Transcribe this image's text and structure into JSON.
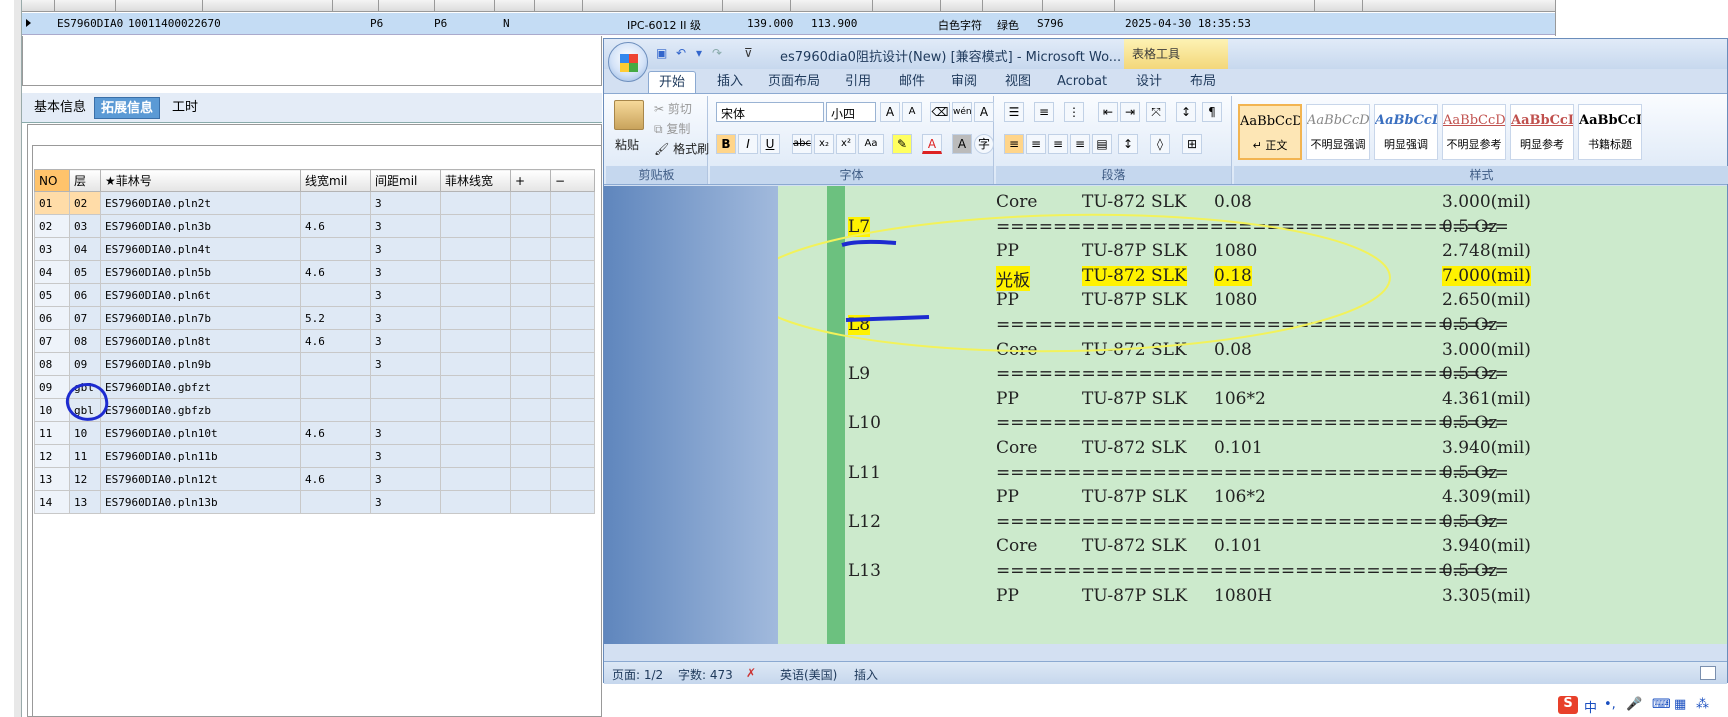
{
  "bg_app": {
    "top_row": {
      "code": "ES7960DIA0",
      "id": "10011400022670",
      "c1": "P6",
      "c2": "P6",
      "c3": "N",
      "grade": "IPC-6012 II 级",
      "v1": "139.000",
      "v2": "113.900",
      "text_type": "白色字符",
      "color": "绿色",
      "s_code": "S796",
      "datetime": "2025-04-30 18:35:53"
    },
    "tabs": [
      "基本信息",
      "拓展信息",
      "工时"
    ],
    "grid": {
      "columns": [
        "NO",
        "层",
        "★菲林号",
        "线宽mil",
        "间距mil",
        "菲林线宽",
        "+",
        "−"
      ],
      "rows": [
        [
          "01",
          "02",
          "ES7960DIA0.pln2t",
          "",
          "3",
          "",
          "",
          ""
        ],
        [
          "02",
          "03",
          "ES7960DIA0.pln3b",
          "4.6",
          "3",
          "",
          "",
          ""
        ],
        [
          "03",
          "04",
          "ES7960DIA0.pln4t",
          "",
          "3",
          "",
          "",
          ""
        ],
        [
          "04",
          "05",
          "ES7960DIA0.pln5b",
          "4.6",
          "3",
          "",
          "",
          ""
        ],
        [
          "05",
          "06",
          "ES7960DIA0.pln6t",
          "",
          "3",
          "",
          "",
          ""
        ],
        [
          "06",
          "07",
          "ES7960DIA0.pln7b",
          "5.2",
          "3",
          "",
          "",
          ""
        ],
        [
          "07",
          "08",
          "ES7960DIA0.pln8t",
          "4.6",
          "3",
          "",
          "",
          ""
        ],
        [
          "08",
          "09",
          "ES7960DIA0.pln9b",
          "",
          "3",
          "",
          "",
          ""
        ],
        [
          "09",
          "gbl",
          "ES7960DIA0.gbfzt",
          "",
          "",
          "",
          "",
          ""
        ],
        [
          "10",
          "gbl",
          "ES7960DIA0.gbfzb",
          "",
          "",
          "",
          "",
          ""
        ],
        [
          "11",
          "10",
          "ES7960DIA0.pln10t",
          "4.6",
          "3",
          "",
          "",
          ""
        ],
        [
          "12",
          "11",
          "ES7960DIA0.pln11b",
          "",
          "3",
          "",
          "",
          ""
        ],
        [
          "13",
          "12",
          "ES7960DIA0.pln12t",
          "4.6",
          "3",
          "",
          "",
          ""
        ],
        [
          "14",
          "13",
          "ES7960DIA0.pln13b",
          "",
          "3",
          "",
          "",
          ""
        ]
      ]
    }
  },
  "word": {
    "title": "es7960dia0阻抗设计(New) [兼容模式] - Microsoft Wo...",
    "table_tools": "表格工具",
    "ribbon_tabs": [
      "开始",
      "插入",
      "页面布局",
      "引用",
      "邮件",
      "审阅",
      "视图",
      "Acrobat",
      "设计",
      "布局"
    ],
    "clipboard": {
      "paste": "粘贴",
      "cut": "剪切",
      "copy": "复制",
      "format_painter": "格式刷",
      "label": "剪贴板"
    },
    "font": {
      "name": "宋体",
      "size": "小四",
      "label": "字体"
    },
    "paragraph": {
      "label": "段落"
    },
    "styles": {
      "label": "样式",
      "items": [
        {
          "preview": "AaBbCcDc",
          "name": "↵ 正文"
        },
        {
          "preview": "AaBbCcDc",
          "name": "不明显强调"
        },
        {
          "preview": "AaBbCcDc",
          "name": "明显强调"
        },
        {
          "preview": "AaBbCcDc",
          "name": "不明显参考"
        },
        {
          "preview": "AaBbCcI",
          "name": "明显参考"
        },
        {
          "preview": "AaBbCcI",
          "name": "书籍标题"
        }
      ]
    },
    "doc_lines": [
      {
        "layer": "",
        "material": "Core",
        "spec": "TU-872 SLK",
        "val": "0.08",
        "thk": "3.000(mil)"
      },
      {
        "layer": "L7",
        "material": "====================================",
        "spec": "",
        "val": "",
        "thk": "0.5 Oz"
      },
      {
        "layer": "",
        "material": "PP",
        "spec": "TU-87P SLK",
        "val": "1080",
        "thk": "2.748(mil)"
      },
      {
        "layer": "",
        "material": "光板",
        "spec": "TU-872 SLK",
        "val": "0.18",
        "thk": "7.000(mil)"
      },
      {
        "layer": "",
        "material": "PP",
        "spec": "TU-87P SLK",
        "val": "1080",
        "thk": "2.650(mil)"
      },
      {
        "layer": "L8",
        "material": "====================================",
        "spec": "",
        "val": "",
        "thk": "0.5 Oz"
      },
      {
        "layer": "",
        "material": "Core",
        "spec": "TU-872 SLK",
        "val": "0.08",
        "thk": "3.000(mil)"
      },
      {
        "layer": "L9",
        "material": "====================================",
        "spec": "",
        "val": "",
        "thk": "0.5 Oz"
      },
      {
        "layer": "",
        "material": "PP",
        "spec": "TU-87P SLK",
        "val": "106*2",
        "thk": "4.361(mil)"
      },
      {
        "layer": "L10",
        "material": "====================================",
        "spec": "",
        "val": "",
        "thk": "0.5 Oz"
      },
      {
        "layer": "",
        "material": "Core",
        "spec": "TU-872 SLK",
        "val": "0.101",
        "thk": "3.940(mil)"
      },
      {
        "layer": "L11",
        "material": "====================================",
        "spec": "",
        "val": "",
        "thk": "0.5 Oz"
      },
      {
        "layer": "",
        "material": "PP",
        "spec": "TU-87P SLK",
        "val": "106*2",
        "thk": "4.309(mil)"
      },
      {
        "layer": "L12",
        "material": "====================================",
        "spec": "",
        "val": "",
        "thk": "0.5 Oz"
      },
      {
        "layer": "",
        "material": "Core",
        "spec": "TU-872 SLK",
        "val": "0.101",
        "thk": "3.940(mil)"
      },
      {
        "layer": "L13",
        "material": "====================================",
        "spec": "",
        "val": "",
        "thk": "0.5 Oz"
      },
      {
        "layer": "",
        "material": "PP",
        "spec": "TU-87P SLK",
        "val": "1080H",
        "thk": "3.305(mil)"
      }
    ],
    "status": {
      "page": "页面: 1/2",
      "words": "字数: 473",
      "lang": "英语(美国)",
      "mode": "插入"
    }
  },
  "ime": {
    "label": "中"
  }
}
